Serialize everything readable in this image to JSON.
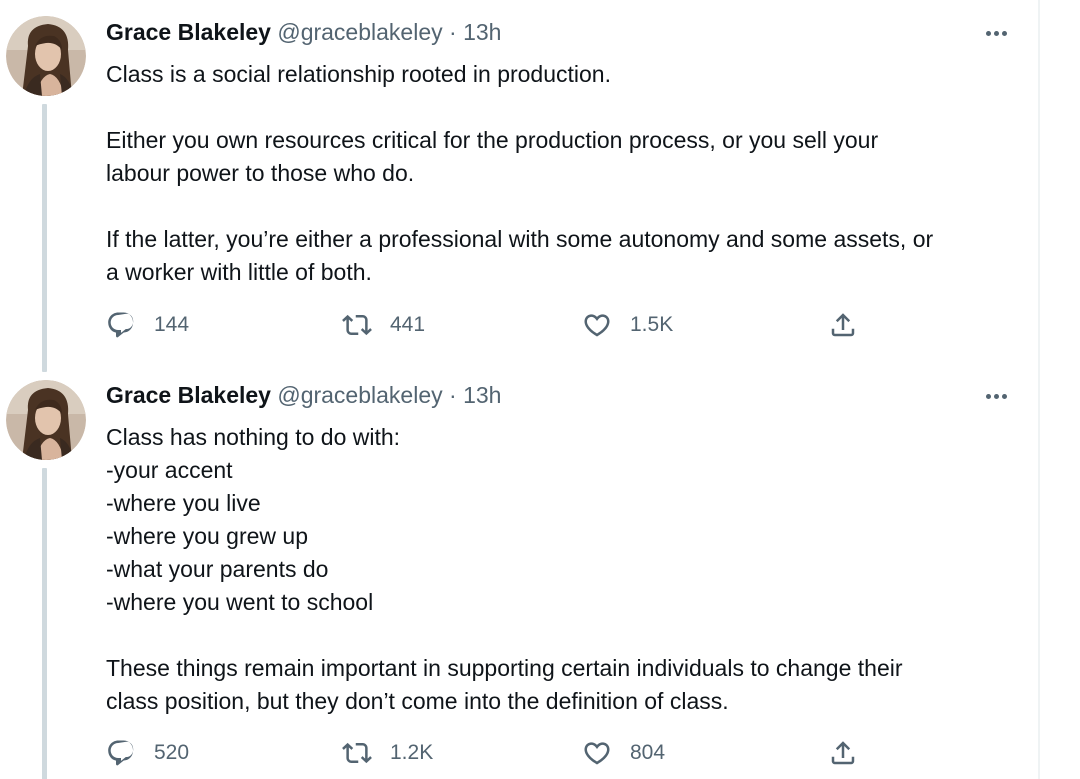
{
  "colors": {
    "text": "#0f1419",
    "secondary": "#536471",
    "thread_line": "#cfd9de"
  },
  "tweets": [
    {
      "author": {
        "name": "Grace Blakeley",
        "handle": "@graceblakeley"
      },
      "separator": "·",
      "time": "13h",
      "paragraphs": [
        [
          "Class is a social relationship rooted in production."
        ],
        [
          "Either you own resources critical for the production process, or you sell your",
          "labour power to those who do."
        ],
        [
          "If the latter, you’re either a professional with some autonomy and some assets, or",
          "a worker with little of both."
        ]
      ],
      "stats": {
        "replies": "144",
        "retweets": "441",
        "likes": "1.5K"
      },
      "icons": {
        "more": "more-icon",
        "reply": "reply-icon",
        "retweet": "retweet-icon",
        "like": "heart-icon",
        "share": "share-icon"
      }
    },
    {
      "author": {
        "name": "Grace Blakeley",
        "handle": "@graceblakeley"
      },
      "separator": "·",
      "time": "13h",
      "paragraphs": [
        [
          "Class has nothing to do with:",
          "-your accent",
          "-where you live",
          "-where you grew up",
          "-what your parents do",
          "-where you went to school"
        ],
        [
          "These things remain important in supporting certain individuals to change their",
          "class position, but they don’t come into the definition of class."
        ]
      ],
      "stats": {
        "replies": "520",
        "retweets": "1.2K",
        "likes": "804"
      },
      "icons": {
        "more": "more-icon",
        "reply": "reply-icon",
        "retweet": "retweet-icon",
        "like": "heart-icon",
        "share": "share-icon"
      }
    }
  ]
}
